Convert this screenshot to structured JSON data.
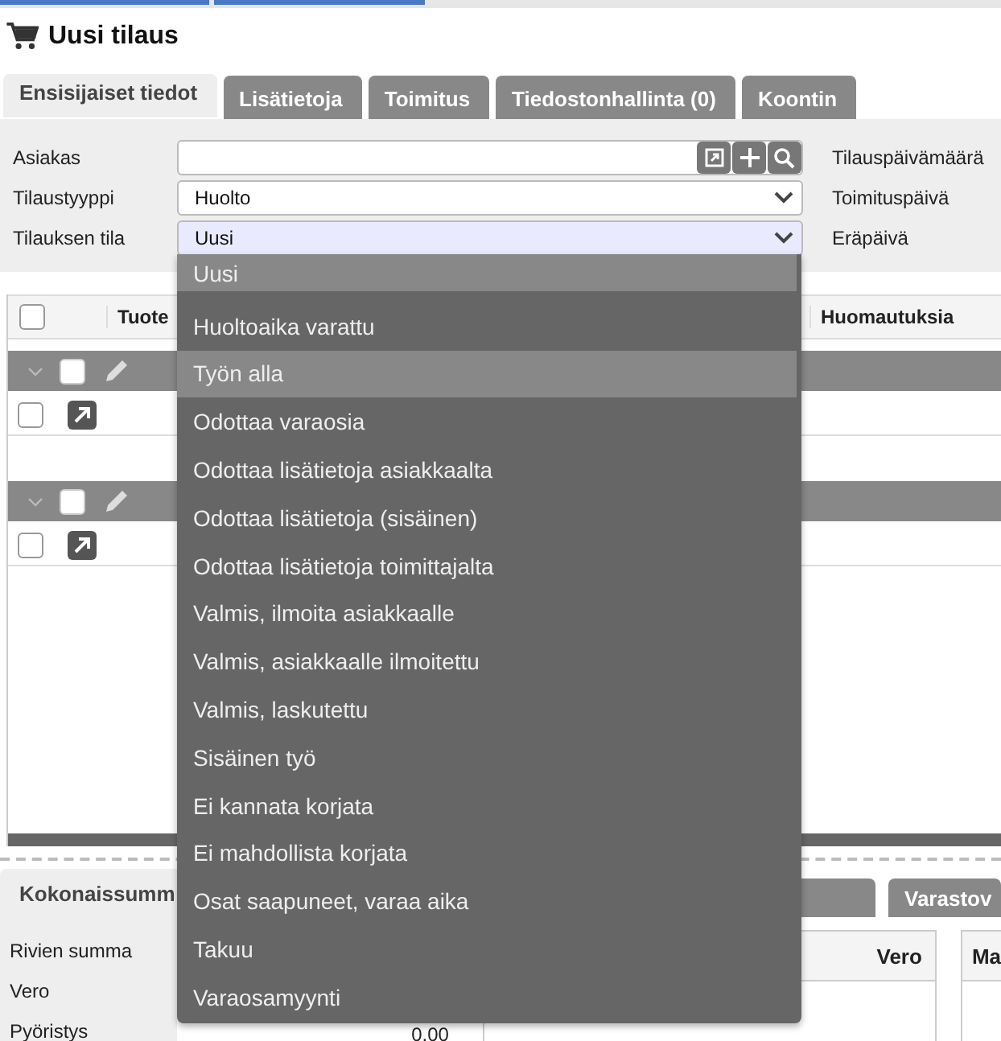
{
  "title": "Uusi tilaus",
  "tabs": [
    {
      "label": "Ensisijaiset tiedot",
      "selected": true
    },
    {
      "label": "Lisätietoja",
      "selected": false
    },
    {
      "label": "Toimitus",
      "selected": false
    },
    {
      "label": "Tiedostonhallinta (0)",
      "selected": false
    },
    {
      "label": "Koontin",
      "selected": false
    }
  ],
  "form": {
    "fields": [
      {
        "label": "Asiakas",
        "kind": "lookup"
      },
      {
        "label": "Tilaustyyppi",
        "kind": "select",
        "value": "Huolto"
      },
      {
        "label": "Tilauksen tila",
        "kind": "select",
        "value": "Uusi",
        "focused": true
      }
    ],
    "right_labels": [
      "Tilauspäivämäärä",
      "Toimituspäivä",
      "Eräpäivä"
    ]
  },
  "table": {
    "columns": [
      "Tuote",
      "Huomautuksia"
    ],
    "all_checked": false,
    "groups": [
      {
        "expanded": true,
        "checked": false,
        "rows": [
          {
            "checked": false
          }
        ]
      },
      {
        "expanded": true,
        "checked": false,
        "rows": [
          {
            "checked": false
          }
        ]
      }
    ]
  },
  "dropdown": {
    "options": [
      {
        "label": "Uusi",
        "selected": true,
        "hovered": false
      },
      {
        "label": "Huoltoaika varattu",
        "selected": false,
        "hovered": false
      },
      {
        "label": "Työn alla",
        "selected": false,
        "hovered": true
      },
      {
        "label": "Odottaa varaosia",
        "selected": false,
        "hovered": false
      },
      {
        "label": "Odottaa lisätietoja asiakkaalta",
        "selected": false,
        "hovered": false
      },
      {
        "label": "Odottaa lisätietoja (sisäinen)",
        "selected": false,
        "hovered": false
      },
      {
        "label": "Odottaa lisätietoja toimittajalta",
        "selected": false,
        "hovered": false
      },
      {
        "label": "Valmis, ilmoita asiakkaalle",
        "selected": false,
        "hovered": false
      },
      {
        "label": "Valmis, asiakkaalle ilmoitettu",
        "selected": false,
        "hovered": false
      },
      {
        "label": "Valmis, laskutettu",
        "selected": false,
        "hovered": false
      },
      {
        "label": "Sisäinen työ",
        "selected": false,
        "hovered": false
      },
      {
        "label": "Ei kannata korjata",
        "selected": false,
        "hovered": false
      },
      {
        "label": "Ei mahdollista korjata",
        "selected": false,
        "hovered": false
      },
      {
        "label": "Osat saapuneet, varaa aika",
        "selected": false,
        "hovered": false
      },
      {
        "label": "Takuu",
        "selected": false,
        "hovered": false
      },
      {
        "label": "Varaosamyynti",
        "selected": false,
        "hovered": false
      }
    ]
  },
  "bottom_tabs": [
    {
      "label": "Kokonaissumm",
      "selected": true
    },
    {
      "selected": false
    },
    {
      "label": "Varastov",
      "selected": false
    }
  ],
  "summary": [
    {
      "label": "Rivien summa"
    },
    {
      "label": "Vero"
    },
    {
      "label": "Pyöristys",
      "value": "0.00"
    }
  ],
  "totals_table": {
    "columns": [
      "Vero"
    ]
  },
  "side_table": {
    "columns": [
      "Ma"
    ]
  }
}
